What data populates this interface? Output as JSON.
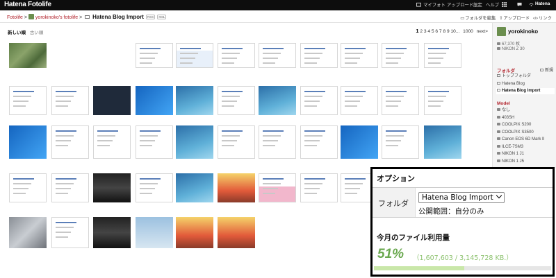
{
  "app": {
    "logo": "Hatena Fotolife"
  },
  "topnav": {
    "mypage": "マイフォト",
    "upload": "アップロード",
    "settings": "設定",
    "help": "ヘルプ",
    "hatena": "Hatena"
  },
  "breadcrumb": {
    "root": "Fotolife",
    "sep": ">",
    "user": "yorokinoko's fotolife",
    "current": "Hatena Blog Import",
    "badge_rss": "RSS",
    "badge_xml": "XML"
  },
  "actions": {
    "edit_folder": "フォルダを編集",
    "upload": "アップロード",
    "link": "リンク"
  },
  "sort": {
    "newest": "新しい順",
    "oldest": "古い順"
  },
  "pager": {
    "current": "1",
    "pages": [
      "2",
      "3",
      "4",
      "5",
      "6",
      "7",
      "8",
      "9",
      "10..."
    ],
    "last": "1000",
    "next": "next>"
  },
  "sidebar": {
    "username": "yorokinoko",
    "photo_count": "67,370 枚",
    "camera": "NIKON Z 30",
    "folder_heading": "フォルダ",
    "new_folder": "新規",
    "folders": [
      "トップフォルダ",
      "Hatena Blog",
      "Hatena Blog Import"
    ],
    "selected_folder": 2,
    "model_heading": "Model",
    "models": [
      "なし",
      "403SH",
      "COOLPIX S200",
      "COOLPIX S3500",
      "Canon EOS 6D Mark II",
      "ILCE-7SM3",
      "NIKON 1 J1",
      "NIKON 1 J5"
    ]
  },
  "options": {
    "title": "オプション",
    "folder_label": "フォルダ",
    "folder_value": "Hatena Blog Import",
    "visibility": "公開範囲：自分のみ",
    "usage_title": "今月のファイル利用量",
    "usage_percent": "51%",
    "usage_detail": "（1,607,603 / 3,145,728 KB.）",
    "usage_fraction": 0.51
  },
  "colors": {
    "accent": "#b1222b",
    "usage_green": "#6aa84f",
    "topbar": "#0d0d0d"
  },
  "thumbs": [
    {
      "kind": "photo-green"
    },
    {
      "kind": "logo-red"
    },
    {
      "kind": "emblem"
    },
    {
      "kind": "doc"
    },
    {
      "kind": "doc-blue"
    },
    {
      "kind": "doc"
    },
    {
      "kind": "doc"
    },
    {
      "kind": "doc"
    },
    {
      "kind": "doc"
    },
    {
      "kind": "doc"
    },
    {
      "kind": "doc"
    },
    {
      "kind": "doc"
    },
    {
      "kind": "doc"
    },
    {
      "kind": "dark"
    },
    {
      "kind": "blue"
    },
    {
      "kind": "blue-grad"
    },
    {
      "kind": "doc"
    },
    {
      "kind": "blue-grad"
    },
    {
      "kind": "doc"
    },
    {
      "kind": "doc"
    },
    {
      "kind": "doc"
    },
    {
      "kind": "doc"
    },
    {
      "kind": "blue"
    },
    {
      "kind": "doc"
    },
    {
      "kind": "doc"
    },
    {
      "kind": "doc"
    },
    {
      "kind": "blue-grad"
    },
    {
      "kind": "doc"
    },
    {
      "kind": "doc"
    },
    {
      "kind": "doc"
    },
    {
      "kind": "blue"
    },
    {
      "kind": "doc"
    },
    {
      "kind": "blue-grad"
    },
    {
      "kind": "doc"
    },
    {
      "kind": "doc"
    },
    {
      "kind": "photo-dark"
    },
    {
      "kind": "doc"
    },
    {
      "kind": "blue-grad"
    },
    {
      "kind": "poster"
    },
    {
      "kind": "doc-pink"
    },
    {
      "kind": "pink"
    },
    {
      "kind": "doc"
    },
    {
      "kind": "photo-gray"
    },
    {
      "kind": "doc"
    },
    {
      "kind": "photo-dark"
    },
    {
      "kind": "photo-sky"
    },
    {
      "kind": "poster"
    },
    {
      "kind": "poster"
    },
    {
      "kind": "poster-light"
    },
    {
      "kind": "doc"
    },
    {
      "kind": "photo-gray"
    },
    {
      "kind": "photo-green"
    }
  ]
}
